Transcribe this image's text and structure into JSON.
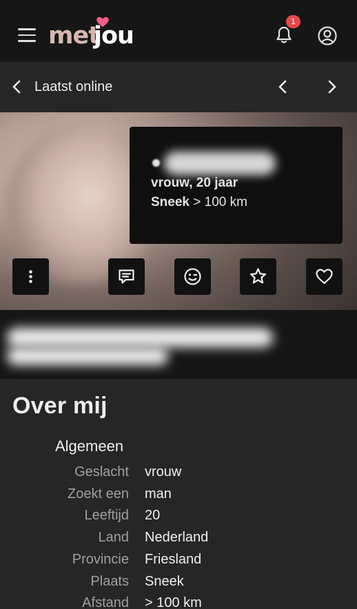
{
  "header": {
    "logo_left": "met",
    "logo_right": "jou",
    "notification_count": "1",
    "brand_color": "#d7b6ad",
    "heart_color": "#f25c8a",
    "badge_color": "#e5484d"
  },
  "nav": {
    "title": "Laatst online"
  },
  "profile": {
    "gender_age": "vrouw, 20 jaar",
    "city": "Sneek",
    "distance": "> 100 km"
  },
  "about": {
    "title": "Over mij",
    "section": "Algemeen",
    "rows": [
      {
        "label": "Geslacht",
        "value": "vrouw"
      },
      {
        "label": "Zoekt een",
        "value": "man"
      },
      {
        "label": "Leeftijd",
        "value": "20"
      },
      {
        "label": "Land",
        "value": "Nederland"
      },
      {
        "label": "Provincie",
        "value": "Friesland"
      },
      {
        "label": "Plaats",
        "value": "Sneek"
      },
      {
        "label": "Afstand",
        "value": "> 100 km"
      }
    ]
  },
  "icons": [
    "menu-icon",
    "bell-icon",
    "account-icon",
    "chevron-left-icon",
    "chevron-right-icon",
    "more-vertical-icon",
    "chat-icon",
    "wink-icon",
    "star-icon",
    "heart-icon"
  ]
}
